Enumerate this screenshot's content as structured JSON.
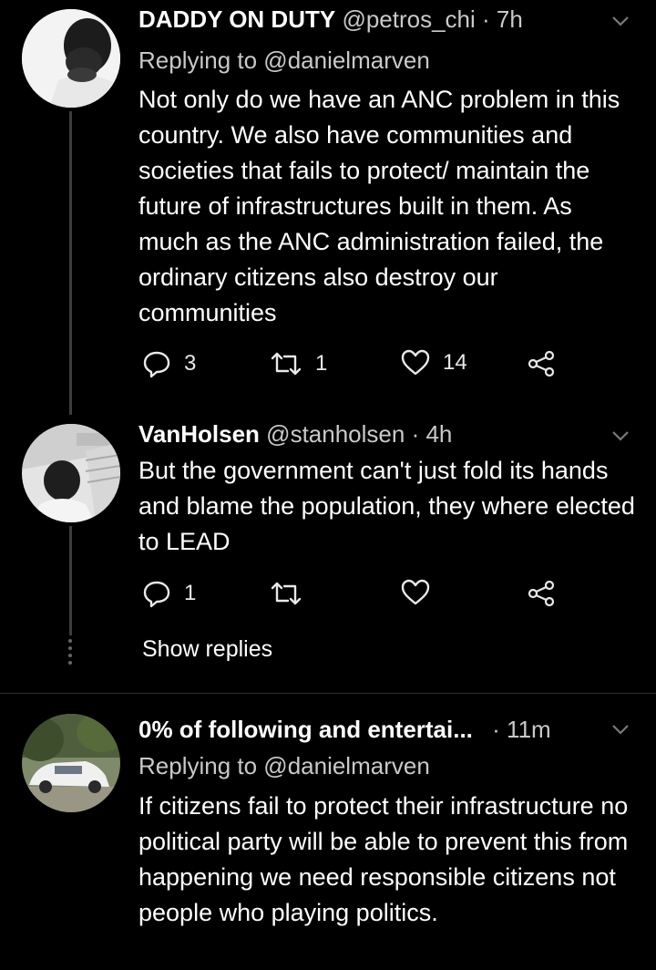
{
  "tweets": [
    {
      "name": "DADDY ON DUTY",
      "handle": "@petros_chi",
      "time": "· 7h",
      "replying": "Replying to @danielmarven",
      "text": "Not only do we have an ANC problem in this country. We also have communities and societies that fails to protect/ maintain the future of infrastructures built in them. As much as the ANC administration failed, the ordinary citizens also destroy our communities",
      "replies": "3",
      "retweets": "1",
      "likes": "14"
    },
    {
      "name": "VanHolsen",
      "handle": "@stanholsen",
      "time": "· 4h",
      "text": "But the government can't just fold its hands and blame the population, they where elected to LEAD",
      "replies": "1",
      "retweets": "",
      "likes": "",
      "show_replies": "Show replies"
    },
    {
      "name": "0% of following and entertai...",
      "time": "· 11m",
      "replying": "Replying to @danielmarven",
      "text": "If citizens fail to protect their infrastructure no political party will be able to prevent this from happening we need responsible citizens not people who playing politics."
    }
  ],
  "icons": {
    "reply": "reply-icon",
    "retweet": "retweet-icon",
    "like": "heart-icon",
    "share": "share-icon",
    "more": "chevron-down-icon"
  },
  "colors": {
    "background": "#000000",
    "text": "#ffffff",
    "muted": "#c9c9c9",
    "icon": "#e8e8e8"
  }
}
